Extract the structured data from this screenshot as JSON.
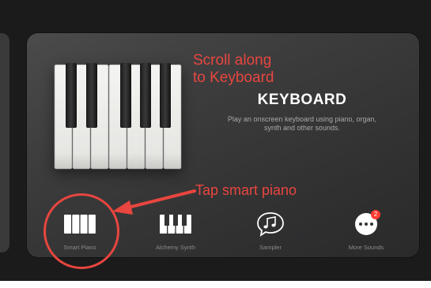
{
  "instrument": {
    "title": "KEYBOARD",
    "description": "Play an onscreen keyboard using piano, organ, synth and other sounds."
  },
  "annotations": {
    "scroll_note": "Scroll along to Keyboard",
    "tap_note": "Tap smart piano",
    "highlight_color": "#e8463f"
  },
  "tabs": [
    {
      "label": "Smart Piano",
      "icon": "smart-piano-icon"
    },
    {
      "label": "Alchemy Synth",
      "icon": "synth-keys-icon"
    },
    {
      "label": "Sampler",
      "icon": "music-note-icon"
    },
    {
      "label": "More Sounds",
      "icon": "more-dots-icon",
      "badge": "2"
    }
  ],
  "colors": {
    "background": "#1b1b1c",
    "card": "#3c3c3d",
    "badge": "#ff3b30"
  }
}
